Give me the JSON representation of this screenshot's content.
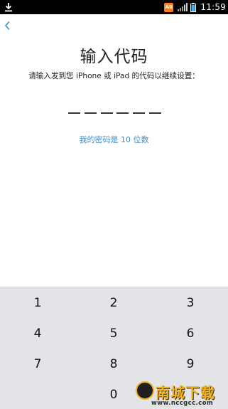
{
  "status_bar": {
    "time": "11:59",
    "download_icon": "download-icon",
    "app_badge": "AB",
    "signal_icon": "signal-icon",
    "battery_icon": "battery-icon"
  },
  "header": {
    "back_icon": "chevron-left-icon"
  },
  "main": {
    "title": "输入代码",
    "subtitle": "请输入发到您 iPhone 或 iPad 的代码以继续设置：",
    "code_length_link": "我的密码是 10 位数",
    "slot_count": 6
  },
  "keypad": {
    "keys": [
      "1",
      "2",
      "3",
      "4",
      "5",
      "6",
      "7",
      "8",
      "9",
      "0"
    ]
  },
  "watermark": {
    "text": "南城下载",
    "url": "www.nccgcc.com"
  },
  "colors": {
    "link": "#3d8ec9",
    "keypad_bg": "#e3e4e8",
    "status_bar_bg": "#000000"
  }
}
